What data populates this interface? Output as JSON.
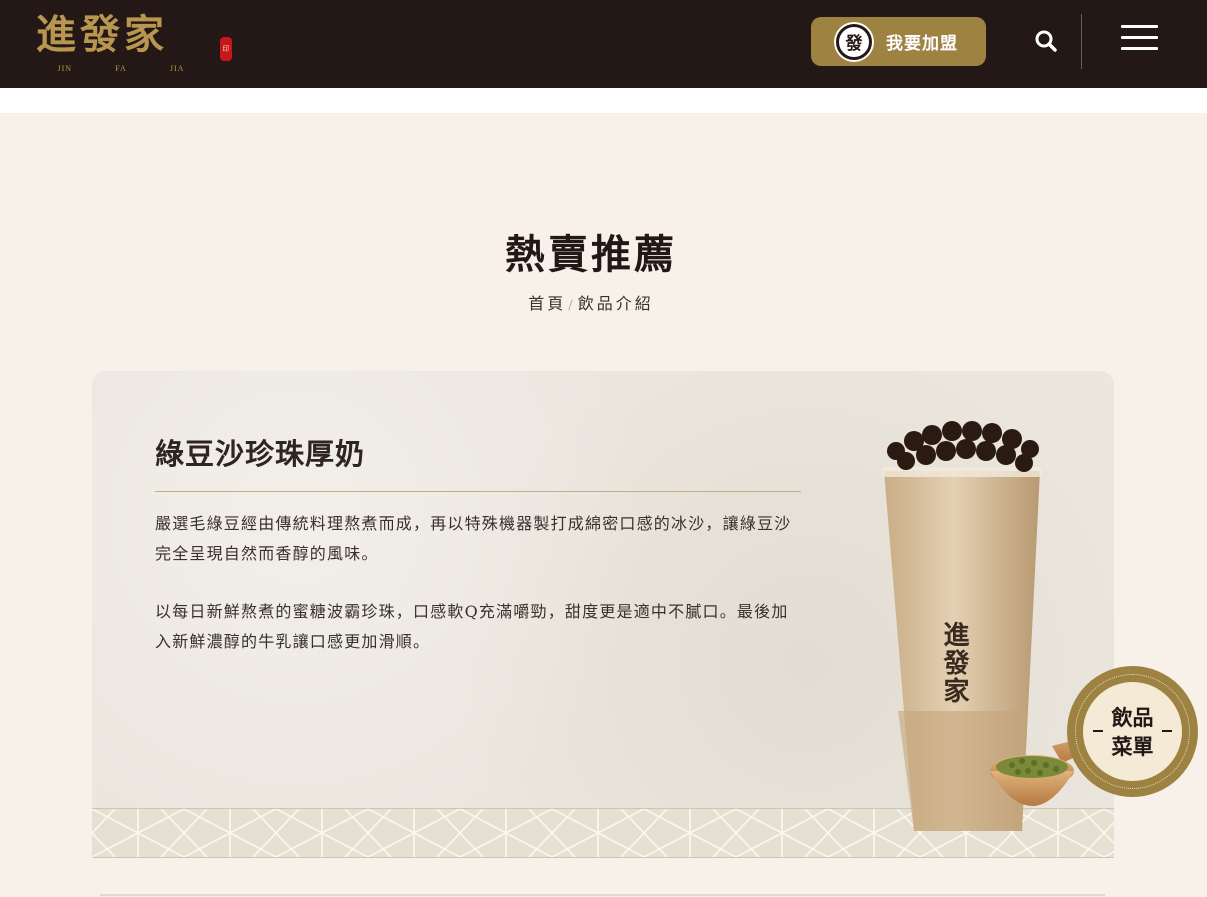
{
  "brand": {
    "name": "進發家",
    "roman": [
      "JIN",
      "FA",
      "JIA"
    ],
    "seal": "印"
  },
  "header": {
    "join_icon_glyph": "發",
    "join_label": "我要加盟",
    "search_icon": "search-icon",
    "menu_icon": "hamburger-menu-icon"
  },
  "page": {
    "title": "熱賣推薦",
    "breadcrumb": {
      "home": "首頁",
      "separator": "/",
      "current": "飲品介紹"
    }
  },
  "product": {
    "name": "綠豆沙珍珠厚奶",
    "description_1": "嚴選毛綠豆經由傳統料理熬煮而成，再以特殊機器製打成綿密口感的冰沙，讓綠豆沙完全呈現自然而香醇的風味。",
    "description_2": "以每日新鮮熬煮的蜜糖波霸珍珠，口感軟Q充滿嚼勁，甜度更是適中不膩口。最後加入新鮮濃醇的牛乳讓口感更加滑順。"
  },
  "floating_badge": {
    "line1": "飲品",
    "line2": "菜單"
  },
  "colors": {
    "header_bg": "#231815",
    "gold": "#9d8241",
    "page_bg": "#f8f1e9",
    "card_bg": "#ebe6de"
  }
}
